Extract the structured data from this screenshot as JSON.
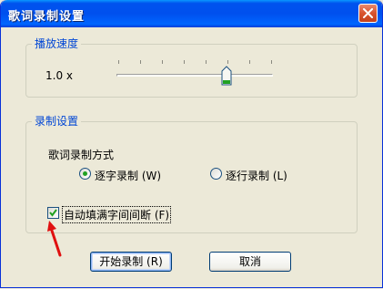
{
  "window": {
    "title": "歌词录制设置"
  },
  "speed_group": {
    "legend": "播放速度",
    "value_label": "1.0 x",
    "slider": {
      "value": 1.0,
      "position_fraction": 0.7
    }
  },
  "record_group": {
    "legend": "录制设置",
    "mode_label": "歌词录制方式",
    "option_char": "逐字录制 (W)",
    "option_line": "逐行录制 (L)",
    "selected": "option_char",
    "auto_fill_label": "自动填满字间间断 (F)",
    "auto_fill_checked": true
  },
  "buttons": {
    "start": "开始录制 (R)",
    "cancel": "取消"
  },
  "colors": {
    "titlebar": "#0053ee",
    "legend_text": "#0046d5",
    "radio_dot": "#21a121",
    "check_mark": "#21a121",
    "annotation_arrow": "#e01010",
    "close_button": "#d9532d"
  },
  "icons": {
    "close": "close-icon",
    "slider_thumb": "slider-thumb-icon",
    "check": "checkmark-icon",
    "annotation": "red-arrow-icon"
  }
}
